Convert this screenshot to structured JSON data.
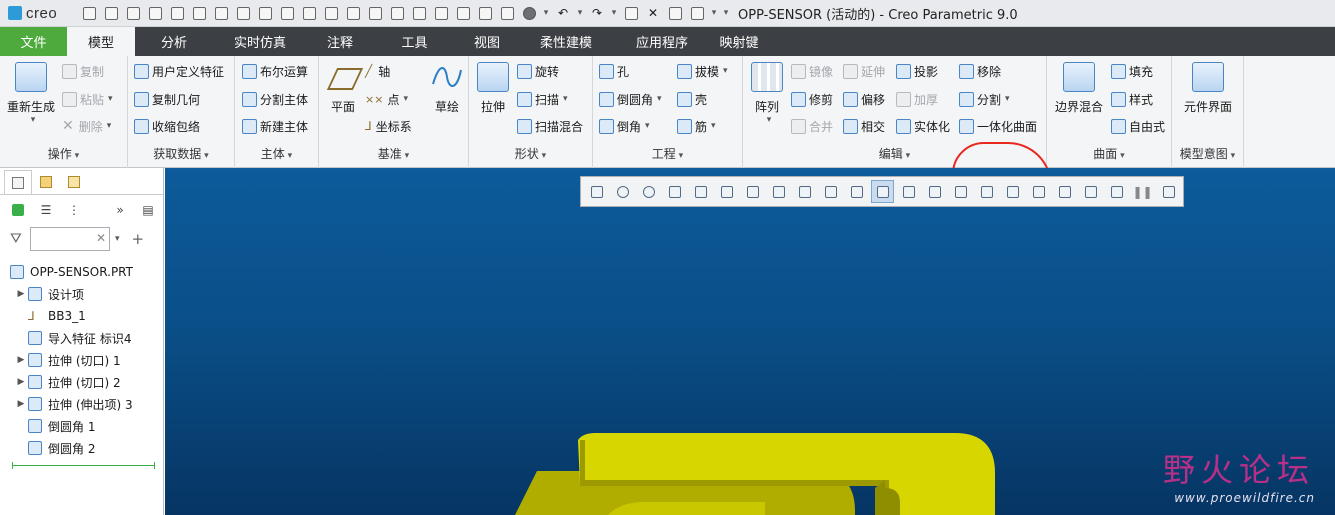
{
  "app": {
    "logo": "creo",
    "window_title": "OPP-SENSOR (活动的) - Creo Parametric 9.0"
  },
  "quick_access": [
    "new-icon",
    "open-icon",
    "save-icon",
    "regenerate-icon",
    "print-icon",
    "undo-icon",
    "redo-icon",
    "close-window-icon",
    "window-icon"
  ],
  "tabs": [
    {
      "label": "文件"
    },
    {
      "label": "模型"
    },
    {
      "label": "分析"
    },
    {
      "label": "实时仿真"
    },
    {
      "label": "注释"
    },
    {
      "label": "工具"
    },
    {
      "label": "视图"
    },
    {
      "label": "柔性建模"
    },
    {
      "label": "应用程序"
    },
    {
      "label": "映射键"
    }
  ],
  "ribbon": {
    "operations": {
      "label": "操作",
      "regenerate": "重新生成",
      "copy": "复制",
      "paste": "粘贴",
      "delete": "删除"
    },
    "get_data": {
      "label": "获取数据",
      "udf": "用户定义特征",
      "copy_geom": "复制几何",
      "shrinkwrap": "收缩包络"
    },
    "body": {
      "label": "主体",
      "boolean": "布尔运算",
      "split_body": "分割主体",
      "new_body": "新建主体"
    },
    "datum": {
      "label": "基准",
      "plane": "平面",
      "axis": "轴",
      "point": "点",
      "csys": "坐标系",
      "sketch": "草绘"
    },
    "shapes": {
      "label": "形状",
      "extrude": "拉伸",
      "revolve": "旋转",
      "sweep": "扫描",
      "swept_blend": "扫描混合"
    },
    "engineering": {
      "label": "工程",
      "hole": "孔",
      "round": "倒圆角",
      "chamfer": "倒角",
      "draft": "拔模",
      "shell": "壳",
      "rib": "筋"
    },
    "editing": {
      "label": "编辑",
      "pattern": "阵列",
      "mirror": "镜像",
      "extend": "延伸",
      "project": "投影",
      "trim": "修剪",
      "offset": "偏移",
      "thicken": "加厚",
      "merge": "合并",
      "intersect": "相交",
      "solidify": "实体化",
      "remove": "移除",
      "split": "分割",
      "unify_surface": "一体化曲面"
    },
    "surfaces": {
      "label": "曲面",
      "boundary_blend": "边界混合",
      "fill": "填充",
      "style": "样式",
      "freestyle": "自由式"
    },
    "model_intent": {
      "label": "模型意图",
      "component_interface": "元件界面"
    }
  },
  "model_tree": {
    "filter_value": "",
    "items": [
      {
        "label": "OPP-SENSOR.PRT"
      },
      {
        "label": "设计项"
      },
      {
        "label": "BB3_1"
      },
      {
        "label": "导入特征 标识4"
      },
      {
        "label": "拉伸 (切口) 1"
      },
      {
        "label": "拉伸 (切口) 2"
      },
      {
        "label": "拉伸 (伸出项) 3"
      },
      {
        "label": "倒圆角 1"
      },
      {
        "label": "倒圆角 2"
      }
    ]
  },
  "graphics_toolbar": [
    "refit-icon",
    "zoom-in-icon",
    "zoom-out-icon",
    "repaint-icon",
    "display-style-icon",
    "saved-orientations-icon",
    "view-manager-icon",
    "perspective-icon",
    "spin-center-icon",
    "annotation-display-icon",
    "plane-display-icon",
    "axis-display-icon",
    "point-display-icon",
    "csys-display-icon",
    "pause-icon"
  ],
  "watermark": {
    "text": "野火论坛",
    "url": "www.proewildfire.cn"
  },
  "colors": {
    "viewport_top": "#0d5b9b",
    "viewport_bottom": "#063563",
    "file_tab": "#4faa3d",
    "model": "#d7d600",
    "annotation": "#e8271f"
  }
}
